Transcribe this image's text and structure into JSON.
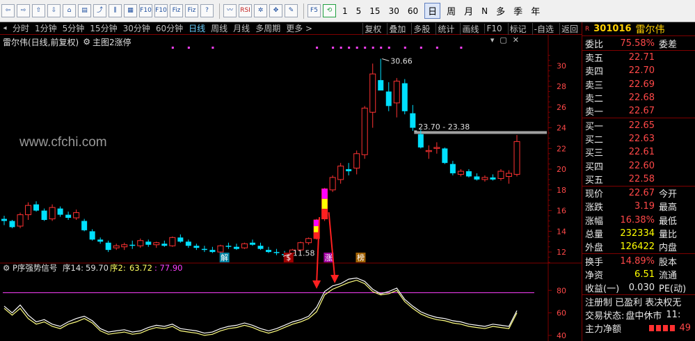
{
  "toolbar": {
    "icons": [
      "back-icon",
      "forward-icon",
      "up-icon",
      "down-icon",
      "home-icon",
      "news-icon",
      "chart-icon",
      "candle-icon",
      "grid-icon",
      "f10-icon",
      "f10-alt-icon",
      "fiz-icon",
      "fiz-alt-icon",
      "help-icon",
      "trend-icon",
      "rsi-icon",
      "tools-icon",
      "move-icon",
      "brush-icon",
      "f5-icon",
      "refresh-icon"
    ],
    "icon_glyphs": [
      "⇦",
      "⇨",
      "⇧",
      "⇩",
      "⌂",
      "▤",
      "⤴",
      "⫼",
      "▦",
      "F10",
      "F10",
      "Fiz",
      "Fiz",
      "?",
      "〰",
      "RSI",
      "✲",
      "✥",
      "✎",
      "F5",
      "⟲"
    ],
    "periods": [
      "1",
      "5",
      "15",
      "30",
      "60",
      "日",
      "周",
      "月",
      "N",
      "多",
      "季",
      "年"
    ],
    "active_period": "日"
  },
  "tabs": {
    "left": [
      "分时",
      "1分钟",
      "5分钟",
      "15分钟",
      "30分钟",
      "60分钟",
      "日线",
      "周线",
      "月线",
      "多周期",
      "更多 >"
    ],
    "active": "日线",
    "right": [
      "复权",
      "叠加",
      "多股",
      "统计",
      "画线",
      "F10",
      "标记",
      "-自选",
      "返回"
    ]
  },
  "chart_header": {
    "stock_title": "雷尔伟(日线,前复权)",
    "main_chart": "主图2涨停"
  },
  "watermark": "www.cfchi.com",
  "annotations": {
    "high_label": "30.66",
    "range_label": "23.70 - 23.38",
    "low_label": "11.58",
    "markers": [
      "解",
      "$",
      "涨",
      "榜"
    ]
  },
  "indicator": {
    "title": "P序强势信号",
    "seq14_label": "序14:",
    "seq14": "59.70",
    "seq2_label": "序2:",
    "seq2": "63.72",
    "extra": ": 77.90"
  },
  "quote": {
    "market": "R",
    "code": "301016",
    "name": "雷尔伟",
    "webi_label": "委比",
    "webi_value": "75.58%",
    "weicha_label": "委差",
    "asks": [
      {
        "label": "卖五",
        "price": "22.71"
      },
      {
        "label": "卖四",
        "price": "22.70"
      },
      {
        "label": "卖三",
        "price": "22.69"
      },
      {
        "label": "卖二",
        "price": "22.68"
      },
      {
        "label": "卖一",
        "price": "22.67"
      }
    ],
    "bids": [
      {
        "label": "买一",
        "price": "22.65"
      },
      {
        "label": "买二",
        "price": "22.63"
      },
      {
        "label": "买三",
        "price": "22.61"
      },
      {
        "label": "买四",
        "price": "22.60"
      },
      {
        "label": "买五",
        "price": "22.58"
      }
    ],
    "stats": [
      {
        "label": "现价",
        "value": "22.67",
        "right": "今开"
      },
      {
        "label": "涨跌",
        "value": "3.19",
        "right": "最高"
      },
      {
        "label": "涨幅",
        "value": "16.38%",
        "right": "最低"
      },
      {
        "label": "总量",
        "value": "232334",
        "right": "量比"
      },
      {
        "label": "外盘",
        "value": "126422",
        "right": "内盘"
      }
    ],
    "stats2": [
      {
        "label": "换手",
        "value": "14.89%",
        "right": "股本"
      },
      {
        "label": "净资",
        "value": "6.51",
        "right": "流通"
      },
      {
        "label": "收益(一)",
        "value": "0.030",
        "right": "PE(动)"
      }
    ],
    "status1": "注册制 已盈利 表决权无",
    "status2_label": "交易状态:",
    "status2_value": "盘中休市",
    "status2_extra": "11:",
    "zhuli_label": "主力净额",
    "zhuli_value": "49"
  },
  "colors": {
    "up": "#ff3232",
    "down": "#00e0ff",
    "axis": "#800000",
    "ma": "#ffffff",
    "signal_line": "#ff40ff"
  },
  "chart_data": {
    "type": "candlestick",
    "ylim": [
      11,
      31.5
    ],
    "yticks": [
      12,
      14,
      16,
      18,
      20,
      22,
      24,
      26,
      28,
      30
    ],
    "candles": [
      [
        15.2,
        15.5,
        14.6,
        15.0
      ],
      [
        15.0,
        15.1,
        14.3,
        14.4
      ],
      [
        14.5,
        15.8,
        14.3,
        15.6
      ],
      [
        15.6,
        16.8,
        15.1,
        16.5
      ],
      [
        16.6,
        16.9,
        15.9,
        16.0
      ],
      [
        16.0,
        16.2,
        15.0,
        15.1
      ],
      [
        15.2,
        16.6,
        15.0,
        16.3
      ],
      [
        16.2,
        16.4,
        15.4,
        15.6
      ],
      [
        15.6,
        15.9,
        15.1,
        15.3
      ],
      [
        15.3,
        16.1,
        15.1,
        15.8
      ],
      [
        15.0,
        15.2,
        14.0,
        14.1
      ],
      [
        14.0,
        14.2,
        13.1,
        13.2
      ],
      [
        13.2,
        13.4,
        12.8,
        13.0
      ],
      [
        12.9,
        13.1,
        12.0,
        12.2
      ],
      [
        12.4,
        12.8,
        12.2,
        12.6
      ],
      [
        12.5,
        12.9,
        12.2,
        12.7
      ],
      [
        12.7,
        13.1,
        12.3,
        12.6
      ],
      [
        12.6,
        13.3,
        12.4,
        13.1
      ],
      [
        13.0,
        13.2,
        12.5,
        12.7
      ],
      [
        12.7,
        13.0,
        12.4,
        12.9
      ],
      [
        12.8,
        13.1,
        12.5,
        12.6
      ],
      [
        12.6,
        13.5,
        12.5,
        13.4
      ],
      [
        13.4,
        13.7,
        12.9,
        13.0
      ],
      [
        13.0,
        13.2,
        12.4,
        12.6
      ],
      [
        12.6,
        12.8,
        12.2,
        12.4
      ],
      [
        12.3,
        12.6,
        12.0,
        12.2
      ],
      [
        12.2,
        12.5,
        11.9,
        12.0
      ],
      [
        12.0,
        12.7,
        11.8,
        12.6
      ],
      [
        12.6,
        12.9,
        12.3,
        12.5
      ],
      [
        12.5,
        12.8,
        12.2,
        12.3
      ],
      [
        12.4,
        12.9,
        12.3,
        12.8
      ],
      [
        12.9,
        13.2,
        12.6,
        12.7
      ],
      [
        12.6,
        12.9,
        12.2,
        12.3
      ],
      [
        12.2,
        12.5,
        11.9,
        12.0
      ],
      [
        12.0,
        12.3,
        11.7,
        11.9
      ],
      [
        11.8,
        12.1,
        11.58,
        11.7
      ],
      [
        11.9,
        12.3,
        11.8,
        12.2
      ],
      [
        12.2,
        13.0,
        12.1,
        12.9
      ],
      [
        12.9,
        13.4,
        12.7,
        13.3
      ],
      [
        13.3,
        15.2,
        13.2,
        15.1
      ],
      [
        15.2,
        18.2,
        15.0,
        18.1
      ],
      [
        18.0,
        19.4,
        17.8,
        19.2
      ],
      [
        19.0,
        20.6,
        18.6,
        20.3
      ],
      [
        20.0,
        20.6,
        19.4,
        19.8
      ],
      [
        20.1,
        21.8,
        19.5,
        21.5
      ],
      [
        21.4,
        26.1,
        21.0,
        25.9
      ],
      [
        25.5,
        30.2,
        24.0,
        29.2
      ],
      [
        28.6,
        30.66,
        27.8,
        27.6
      ],
      [
        27.5,
        28.4,
        25.6,
        26.1
      ],
      [
        26.4,
        28.8,
        25.0,
        28.5
      ],
      [
        28.3,
        28.7,
        25.3,
        25.6
      ],
      [
        25.4,
        26.2,
        23.7,
        24.0
      ],
      [
        23.38,
        23.8,
        22.0,
        22.1
      ],
      [
        21.7,
        22.3,
        21.0,
        21.8
      ],
      [
        22.0,
        22.6,
        21.5,
        22.1
      ],
      [
        22.0,
        22.1,
        20.5,
        20.6
      ],
      [
        20.5,
        20.8,
        19.4,
        19.6
      ],
      [
        19.5,
        20.0,
        19.3,
        19.8
      ],
      [
        19.8,
        20.0,
        19.2,
        19.3
      ],
      [
        19.3,
        19.6,
        18.9,
        19.0
      ],
      [
        19.0,
        19.4,
        18.8,
        19.2
      ],
      [
        19.2,
        19.5,
        18.9,
        19.0
      ],
      [
        19.1,
        20.0,
        18.9,
        19.8
      ],
      [
        19.3,
        19.9,
        18.6,
        19.6
      ],
      [
        19.5,
        23.3,
        19.3,
        22.67
      ]
    ],
    "support_level": 23.54,
    "indicator": {
      "ylim": [
        35,
        95
      ],
      "yticks": [
        40,
        60,
        80
      ],
      "threshold": 77.9,
      "line1": [
        66,
        60,
        67,
        58,
        52,
        54,
        50,
        48,
        52,
        55,
        57,
        53,
        46,
        43,
        44,
        45,
        43,
        44,
        47,
        49,
        48,
        50,
        46,
        45,
        44,
        42,
        43,
        46,
        48,
        49,
        51,
        49,
        46,
        44,
        46,
        49,
        52,
        54,
        57,
        65,
        79,
        84,
        86,
        90,
        91,
        88,
        81,
        77,
        79,
        82,
        72,
        66,
        61,
        58,
        56,
        55,
        53,
        52,
        50,
        49,
        48,
        50,
        49,
        48,
        62
      ],
      "line2": [
        64,
        58,
        64,
        55,
        50,
        52,
        48,
        46,
        50,
        52,
        55,
        51,
        44,
        41,
        42,
        43,
        41,
        42,
        45,
        47,
        46,
        48,
        44,
        43,
        42,
        40,
        41,
        44,
        46,
        47,
        49,
        47,
        44,
        42,
        44,
        47,
        50,
        52,
        55,
        61,
        76,
        81,
        84,
        87,
        89,
        86,
        79,
        76,
        77,
        80,
        70,
        64,
        59,
        56,
        54,
        53,
        51,
        50,
        48,
        47,
        46,
        48,
        47,
        46,
        60
      ]
    }
  }
}
